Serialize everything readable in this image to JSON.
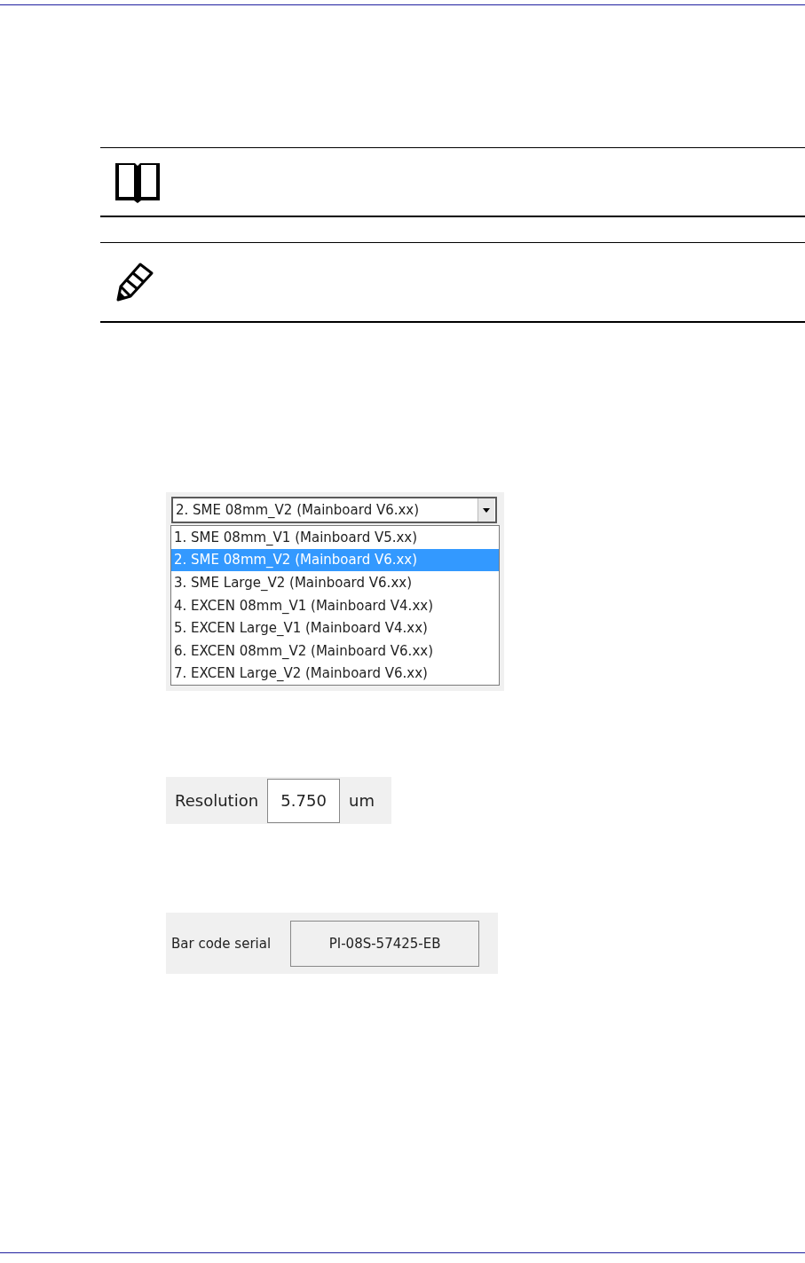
{
  "notes": [
    {
      "kind": "book"
    },
    {
      "kind": "pencil"
    }
  ],
  "model_dropdown": {
    "value": "2. SME 08mm_V2 (Mainboard V6.xx)",
    "expanded": true,
    "options": [
      {
        "label": "1. SME 08mm_V1 (Mainboard V5.xx)",
        "selected": false
      },
      {
        "label": "2. SME 08mm_V2 (Mainboard V6.xx)",
        "selected": true
      },
      {
        "label": "3. SME Large_V2 (Mainboard V6.xx)",
        "selected": false
      },
      {
        "label": "4. EXCEN 08mm_V1 (Mainboard V4.xx)",
        "selected": false
      },
      {
        "label": "5. EXCEN Large_V1 (Mainboard V4.xx)",
        "selected": false
      },
      {
        "label": "6. EXCEN 08mm_V2 (Mainboard V6.xx)",
        "selected": false
      },
      {
        "label": "7. EXCEN Large_V2 (Mainboard V6.xx)",
        "selected": false
      }
    ]
  },
  "resolution": {
    "label": "Resolution",
    "value": "5.750",
    "unit": "um"
  },
  "barcode": {
    "label": "Bar code serial",
    "value": "PI-08S-57425-EB"
  }
}
